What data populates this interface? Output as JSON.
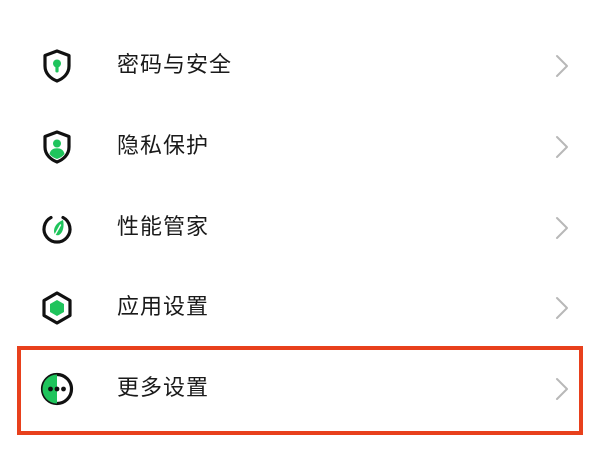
{
  "colors": {
    "accent_green": "#1fc45c",
    "icon_dark": "#111111",
    "chevron": "#b8b8b8",
    "highlight": "#e8401c"
  },
  "settings": {
    "items": [
      {
        "label": "密码与安全",
        "icon": "shield-lock-icon"
      },
      {
        "label": "隐私保护",
        "icon": "shield-person-icon"
      },
      {
        "label": "性能管家",
        "icon": "performance-leaf-icon"
      },
      {
        "label": "应用设置",
        "icon": "app-hexagon-icon"
      },
      {
        "label": "更多设置",
        "icon": "more-dots-icon",
        "highlighted": true
      }
    ]
  }
}
